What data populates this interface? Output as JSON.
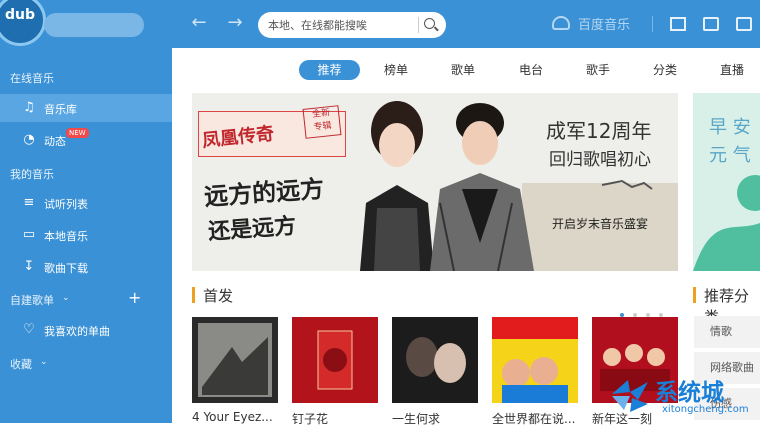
{
  "app": {
    "brand": "百度音乐",
    "logo": "dub"
  },
  "search": {
    "placeholder": "本地、在线都能搜唉"
  },
  "sidebar": {
    "online_section": "在线音乐",
    "my_music_section": "我的音乐",
    "custom_playlists": "自建歌单",
    "favorites_section": "收藏",
    "items": [
      {
        "label": "音乐库",
        "icon": "music-note-icon",
        "active": true
      },
      {
        "label": "动态",
        "icon": "activity-icon",
        "badge": "NEW"
      },
      {
        "label": "试听列表",
        "icon": "playlist-icon"
      },
      {
        "label": "本地音乐",
        "icon": "monitor-icon"
      },
      {
        "label": "歌曲下载",
        "icon": "download-icon"
      },
      {
        "label": "我喜欢的单曲",
        "icon": "heart-icon"
      }
    ]
  },
  "tabs": [
    {
      "label": "推荐",
      "active": true
    },
    {
      "label": "榜单"
    },
    {
      "label": "歌单"
    },
    {
      "label": "电台"
    },
    {
      "label": "歌手"
    },
    {
      "label": "分类"
    },
    {
      "label": "直播"
    }
  ],
  "banner": {
    "tag_name": "凤凰传奇",
    "tag_badge_line1": "全新",
    "tag_badge_line2": "专辑",
    "slogan1": "远方的远方",
    "slogan2": "还是远方",
    "headline": "成军12周年",
    "subline": "回归歌唱初心",
    "cta": "开启岁末音乐盛宴"
  },
  "right_banner": {
    "line1": "早 安",
    "line2": "元 气"
  },
  "sections": {
    "new_releases": "首发",
    "recommend_category": "推荐分类"
  },
  "albums": [
    {
      "title": "4 Your Eyez..."
    },
    {
      "title": "钉子花"
    },
    {
      "title": "一生何求"
    },
    {
      "title": "全世界都在说..."
    },
    {
      "title": "新年这一刻"
    }
  ],
  "genres": [
    "情歌",
    "网络歌曲",
    "伤感"
  ],
  "watermark": {
    "text": "系统城",
    "url": "xitongcheng.com"
  },
  "colors": {
    "accent": "#3b91d6",
    "sidebar_active": "#5aa6e2",
    "section_bar": "#f0a020"
  }
}
